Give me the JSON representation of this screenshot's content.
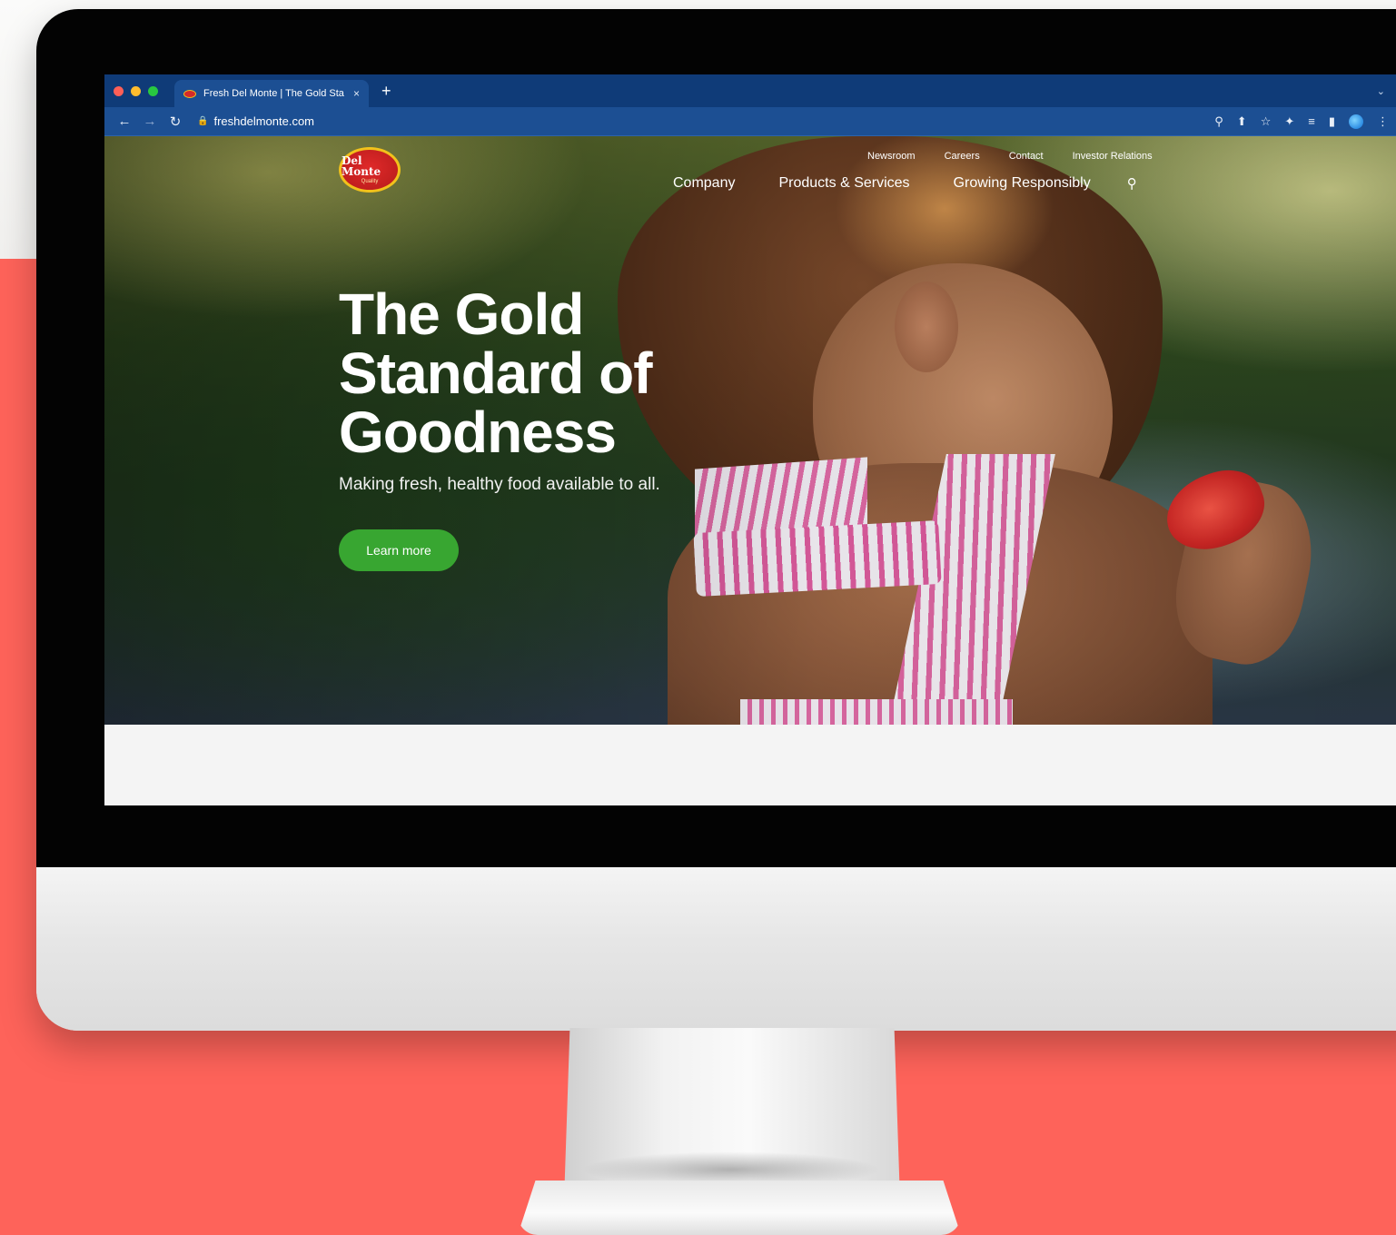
{
  "browser": {
    "tab_title": "Fresh Del Monte | The Gold Sta",
    "tab_close": "×",
    "new_tab": "+",
    "url": "freshdelmonte.com"
  },
  "site": {
    "logo_text": "Del Monte",
    "logo_sub": "Quality",
    "utility_nav": [
      "Newsroom",
      "Careers",
      "Contact",
      "Investor Relations"
    ],
    "main_nav": [
      "Company",
      "Products & Services",
      "Growing Responsibly"
    ],
    "hero": {
      "title_lines": [
        "The Gold",
        "Standard of",
        "Goodness"
      ],
      "subtitle": "Making fresh, healthy food available to all.",
      "cta_label": "Learn more"
    }
  },
  "colors": {
    "browser_chrome": "#1c4f93",
    "titlebar": "#0f3b78",
    "cta_green": "#38a631",
    "backdrop_red": "#fe635a",
    "logo_red": "#e02a2a",
    "logo_gold": "#f2c21b"
  },
  "icons": {
    "back": "arrow-left-icon",
    "forward": "arrow-right-icon",
    "reload": "reload-icon",
    "lock": "lock-icon",
    "zoom": "zoom-icon",
    "share": "share-icon",
    "bookmark": "star-icon",
    "extensions": "puzzle-icon",
    "reading_list": "reading-list-icon",
    "side_panel": "side-panel-icon",
    "menu": "kebab-menu-icon",
    "search": "search-icon"
  }
}
